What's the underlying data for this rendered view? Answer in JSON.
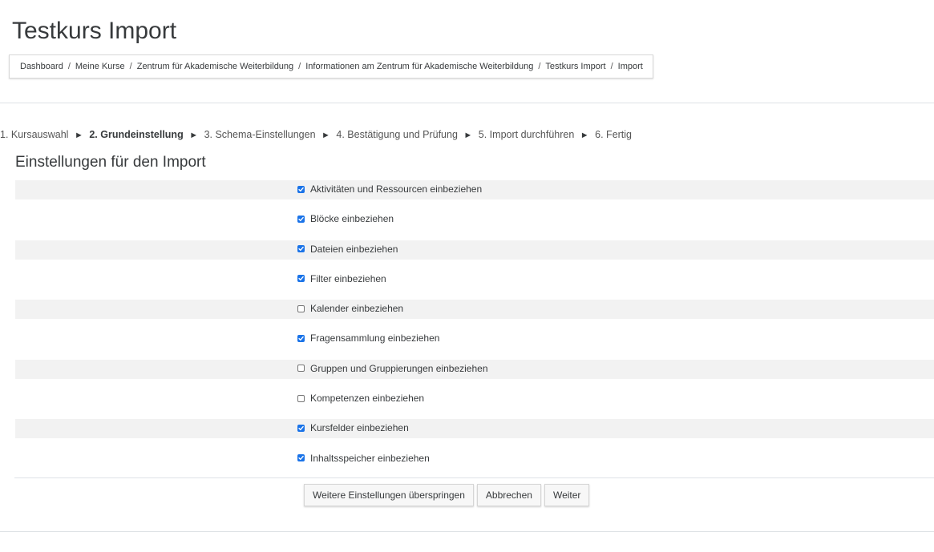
{
  "page": {
    "title": "Testkurs Import"
  },
  "breadcrumb": [
    "Dashboard",
    "Meine Kurse",
    "Zentrum für Akademische Weiterbildung",
    "Informationen am Zentrum für Akademische Weiterbildung",
    "Testkurs Import",
    "Import"
  ],
  "breadcrumb_separator": "/",
  "steps": [
    {
      "label": "1. Kursauswahl",
      "active": false
    },
    {
      "label": "2. Grundeinstellung",
      "active": true
    },
    {
      "label": "3. Schema-Einstellungen",
      "active": false
    },
    {
      "label": "4. Bestätigung und Prüfung",
      "active": false
    },
    {
      "label": "5. Import durchführen",
      "active": false
    },
    {
      "label": "6. Fertig",
      "active": false
    }
  ],
  "step_separator": "►",
  "section": {
    "heading": "Einstellungen für den Import"
  },
  "settings": [
    {
      "label": "Aktivitäten und Ressourcen einbeziehen",
      "checked": true
    },
    {
      "label": "Blöcke einbeziehen",
      "checked": true
    },
    {
      "label": "Dateien einbeziehen",
      "checked": true
    },
    {
      "label": "Filter einbeziehen",
      "checked": true
    },
    {
      "label": "Kalender einbeziehen",
      "checked": false
    },
    {
      "label": "Fragensammlung einbeziehen",
      "checked": true
    },
    {
      "label": "Gruppen und Gruppierungen einbeziehen",
      "checked": false
    },
    {
      "label": "Kompetenzen einbeziehen",
      "checked": false
    },
    {
      "label": "Kursfelder einbeziehen",
      "checked": true
    },
    {
      "label": "Inhaltsspeicher einbeziehen",
      "checked": true
    }
  ],
  "buttons": {
    "skip": "Weitere Einstellungen überspringen",
    "cancel": "Abbrechen",
    "next": "Weiter"
  },
  "colors": {
    "checkbox_checked": "#1a73e8",
    "row_band": "#f2f2f2",
    "text": "#373a3c"
  }
}
